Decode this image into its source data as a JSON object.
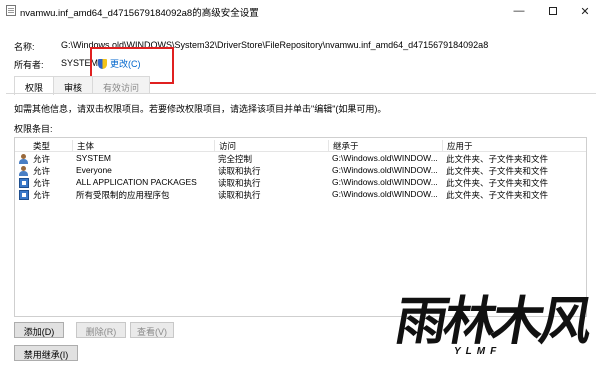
{
  "window": {
    "title": "nvamwu.inf_amd64_d4715679184092a8的高级安全设置",
    "minimize_glyph": "—",
    "close_glyph": "✕"
  },
  "header": {
    "name_label": "名称:",
    "name_value": "G:\\Windows.old\\WINDOWS\\System32\\DriverStore\\FileRepository\\nvamwu.inf_amd64_d4715679184092a8",
    "owner_label": "所有者:",
    "owner_value": "SYSTEM",
    "change_label": "更改(C)",
    "change_icon": "uac-shield-icon"
  },
  "tabs": [
    {
      "label": "权限",
      "active": true
    },
    {
      "label": "审核",
      "active": false
    },
    {
      "label": "有效访问",
      "active": false
    }
  ],
  "info_text": "如需其他信息，请双击权限项目。若要修改权限项目，请选择该项目并单击\"编辑\"(如果可用)。",
  "entries_label": "权限条目:",
  "grid": {
    "columns": [
      "类型",
      "主体",
      "访问",
      "继承于",
      "应用于"
    ],
    "rows": [
      {
        "icon": "user-icon",
        "type": "允许",
        "principal": "SYSTEM",
        "access": "完全控制",
        "inherited": "G:\\Windows.old\\WINDOW...",
        "applies": "此文件夹、子文件夹和文件"
      },
      {
        "icon": "user-icon",
        "type": "允许",
        "principal": "Everyone",
        "access": "读取和执行",
        "inherited": "G:\\Windows.old\\WINDOW...",
        "applies": "此文件夹、子文件夹和文件"
      },
      {
        "icon": "package-icon",
        "type": "允许",
        "principal": "ALL APPLICATION PACKAGES",
        "access": "读取和执行",
        "inherited": "G:\\Windows.old\\WINDOW...",
        "applies": "此文件夹、子文件夹和文件"
      },
      {
        "icon": "package-icon",
        "type": "允许",
        "principal": "所有受限制的应用程序包",
        "access": "读取和执行",
        "inherited": "G:\\Windows.old\\WINDOW...",
        "applies": "此文件夹、子文件夹和文件"
      }
    ]
  },
  "buttons": {
    "add": "添加(D)",
    "remove": "删除(R)",
    "view": "查看(V)",
    "disable_inheritance": "禁用继承(I)"
  },
  "watermark": {
    "logo_text": "雨林木风",
    "sub_text": "YLMF"
  },
  "colors": {
    "highlight_box": "#e02020",
    "link": "#0066cc"
  }
}
